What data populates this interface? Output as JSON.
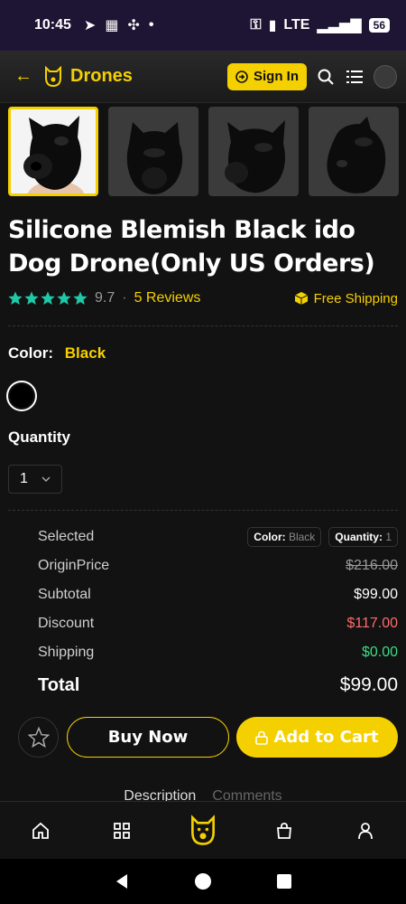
{
  "status_bar": {
    "time": "10:45",
    "network": "LTE",
    "battery": "56"
  },
  "header": {
    "brand": "Drones",
    "sign_in_label": "Sign In"
  },
  "product": {
    "title": "Silicone Blemish Black ido Dog Drone(Only US Orders)",
    "rating": "9.7",
    "separator": "·",
    "reviews_label": "5 Reviews",
    "shipping_label": "Free Shipping",
    "color_label": "Color:",
    "color_value": "Black",
    "quantity_label": "Quantity",
    "quantity_value": "1"
  },
  "summary": {
    "selected_label": "Selected",
    "chip_color_key": "Color:",
    "chip_color_val": "Black",
    "chip_qty_key": "Quantity:",
    "chip_qty_val": "1",
    "origin_label": "OriginPrice",
    "origin_val": "$216.00",
    "subtotal_label": "Subtotal",
    "subtotal_val": "$99.00",
    "discount_label": "Discount",
    "discount_val": "$117.00",
    "shipping_label": "Shipping",
    "shipping_val": "$0.00",
    "total_label": "Total",
    "total_val": "$99.00"
  },
  "actions": {
    "buy_now": "Buy Now",
    "add_to_cart": "Add to Cart"
  },
  "tabs": {
    "description": "Description",
    "comments": "Comments"
  },
  "colors": {
    "accent": "#f5d000",
    "star": "#1fc9a8",
    "discount": "#ff6b6b",
    "shipping_free": "#3ddc84"
  }
}
